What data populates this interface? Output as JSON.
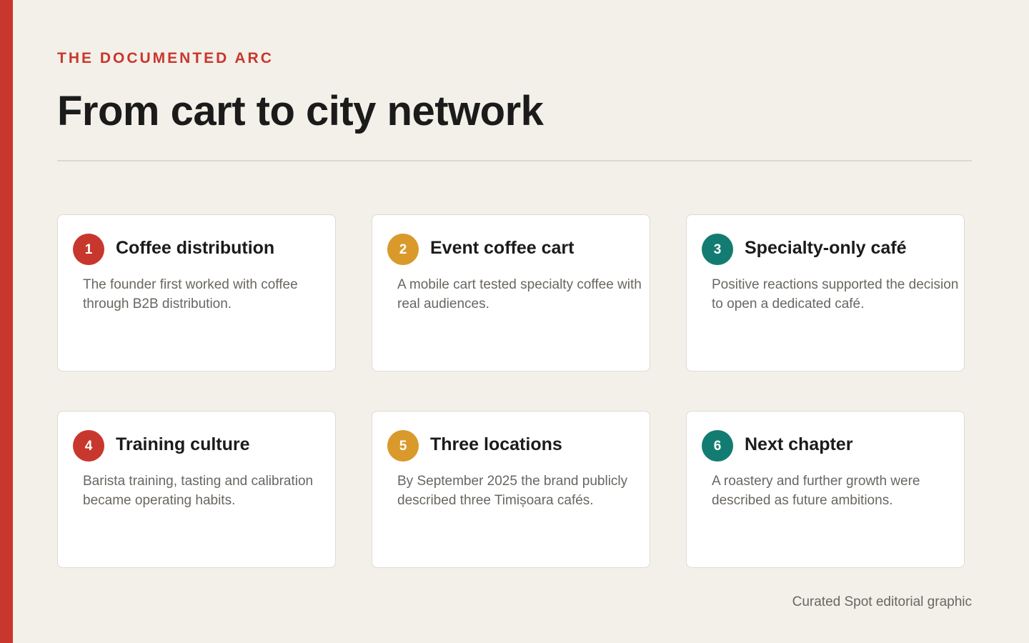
{
  "header": {
    "eyebrow": "THE DOCUMENTED ARC",
    "title": "From cart to city network"
  },
  "steps": [
    {
      "number": "1",
      "title": "Coffee distribution",
      "text": "The founder first worked with coffee through B2B distribution.",
      "color": "#c8372d"
    },
    {
      "number": "2",
      "title": "Event coffee cart",
      "text": "A mobile cart tested specialty coffee with real audiences.",
      "color": "#d99a2b"
    },
    {
      "number": "3",
      "title": "Specialty-only café",
      "text": "Positive reactions supported the decision to open a dedicated café.",
      "color": "#137c72"
    },
    {
      "number": "4",
      "title": "Training culture",
      "text": "Barista training, tasting and calibration became operating habits.",
      "color": "#c8372d"
    },
    {
      "number": "5",
      "title": "Three locations",
      "text": "By September 2025 the brand publicly described three Timișoara cafés.",
      "color": "#d99a2b"
    },
    {
      "number": "6",
      "title": "Next chapter",
      "text": "A roastery and further growth were described as future ambitions.",
      "color": "#137c72"
    }
  ],
  "footer": {
    "credit": "Curated Spot editorial graphic"
  },
  "colors": {
    "accent": "#c8372d",
    "gold": "#d99a2b",
    "teal": "#137c72",
    "background": "#f3f0e9"
  }
}
